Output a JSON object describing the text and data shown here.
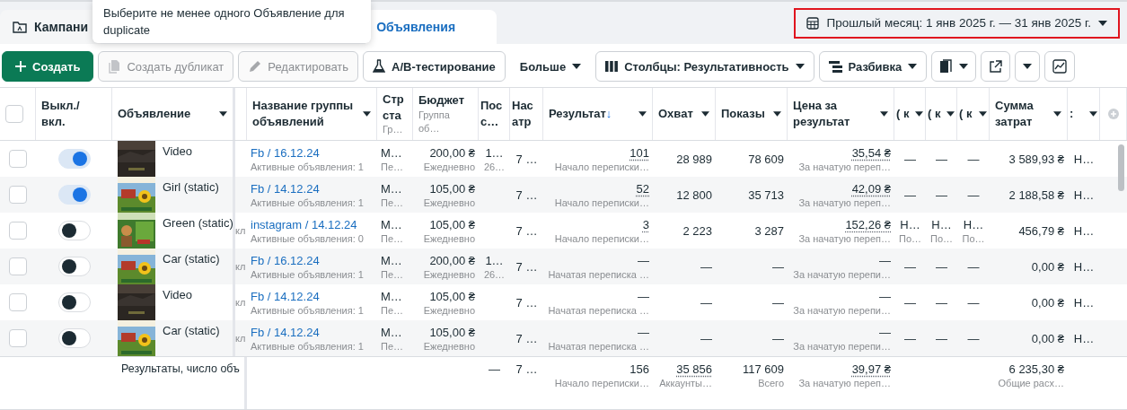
{
  "tooltip": {
    "text": "Выберите не менее одного Объявление для duplicate"
  },
  "tabs": [
    {
      "label": "Кампани",
      "selected": false
    },
    {
      "label": "Объявления",
      "selected": true
    }
  ],
  "date_range": {
    "label": "Прошлый месяц: 1 янв 2025 г. — 31 янв 2025 г.",
    "highlighted": true
  },
  "toolbar": [
    {
      "kind": "primary",
      "label": "Создать",
      "disabled": false,
      "caret": false
    },
    {
      "kind": "button",
      "label": "Создать дубликат",
      "disabled": true,
      "caret": false
    },
    {
      "kind": "button",
      "label": "Редактировать",
      "disabled": true,
      "caret": false
    },
    {
      "kind": "button",
      "label": "A/B-тестирование",
      "disabled": false,
      "caret": false
    },
    {
      "kind": "menu",
      "label": "Больше",
      "disabled": false,
      "caret": true
    },
    {
      "kind": "button",
      "label": "Столбцы: Результативность",
      "disabled": false,
      "caret": true
    },
    {
      "kind": "button",
      "label": "Разбивка",
      "disabled": false,
      "caret": true
    },
    {
      "kind": "icon",
      "disabled": false,
      "caret": true
    },
    {
      "kind": "icon",
      "disabled": false,
      "caret": false
    },
    {
      "kind": "icon",
      "disabled": false,
      "caret": true
    },
    {
      "kind": "icon",
      "disabled": false,
      "caret": false
    }
  ],
  "table": {
    "select_all": {
      "checked": false
    },
    "toggle_column": {
      "label": "Выкл./ вкл."
    },
    "ad_column": {
      "label": "Объявление",
      "caret": true
    },
    "columns": [
      {
        "kind": "text"
      },
      {
        "kind": "link",
        "label": "Название группы объявлений",
        "caret": true
      },
      {
        "kind": "text",
        "label": "Стр ста",
        "sub": "Гр…",
        "caret": false
      },
      {
        "kind": "text",
        "label": "Бюджет",
        "sub": "Группа об…",
        "caret": false
      },
      {
        "kind": "text",
        "label": "Пос с…",
        "caret": false
      },
      {
        "kind": "text",
        "label": "Нас атр",
        "caret": false
      },
      {
        "kind": "text",
        "label": "Результат",
        "sort": "↓",
        "caret": true
      },
      {
        "kind": "text",
        "label": "Охват",
        "caret": true
      },
      {
        "kind": "text",
        "label": "Показы",
        "caret": true
      },
      {
        "kind": "text",
        "label": "Цена за результат",
        "caret": true
      },
      {
        "kind": "text",
        "label": "( к",
        "caret": true
      },
      {
        "kind": "text",
        "label": "( к",
        "caret": true
      },
      {
        "kind": "text",
        "label": "( к",
        "caret": true
      },
      {
        "kind": "text",
        "label": "Сумма затрат",
        "caret": true
      },
      {
        "kind": "text",
        "label": ":",
        "caret": true
      },
      {
        "kind": "add"
      }
    ],
    "rows": [
      {
        "checked": false,
        "on": true,
        "ad": "Video",
        "cells": [
          {},
          {
            "text": "Fb / 16.12.24",
            "sub": "Активные объявления: 1"
          },
          {
            "text": "М…",
            "sub": "Пе…"
          },
          {
            "text": "200,00 ₴",
            "sub": "Ежедневно"
          },
          {
            "text": "1…",
            "sub": "26…"
          },
          {
            "text": "7 …"
          },
          {
            "text": "101",
            "sub": "Начало переписки…",
            "dotted": true
          },
          {
            "text": "28 989"
          },
          {
            "text": "78 609"
          },
          {
            "text": "35,54 ₴",
            "sub": "За начатую переп…",
            "dotted": true
          },
          {
            "text": "—"
          },
          {
            "text": "—"
          },
          {
            "text": "—"
          },
          {
            "text": "3 589,93 ₴"
          },
          {
            "text": "Н…"
          }
        ]
      },
      {
        "checked": false,
        "on": true,
        "ad": "Girl (static)",
        "cells": [
          {},
          {
            "text": "Fb / 14.12.24",
            "sub": "Активные объявления: 1"
          },
          {
            "text": "М…",
            "sub": "Пе…"
          },
          {
            "text": "105,00 ₴",
            "sub": "Ежедневно"
          },
          {},
          {
            "text": "7 …"
          },
          {
            "text": "52",
            "sub": "Начало переписки…",
            "dotted": true
          },
          {
            "text": "12 800"
          },
          {
            "text": "35 713"
          },
          {
            "text": "42,09 ₴",
            "sub": "За начатую переп…",
            "dotted": true
          },
          {
            "text": "—"
          },
          {
            "text": "—"
          },
          {
            "text": "—"
          },
          {
            "text": "2 188,58 ₴"
          },
          {
            "text": "Н…"
          }
        ]
      },
      {
        "checked": false,
        "on": false,
        "ad": "Green (static)",
        "cells": [
          {
            "text": "кл"
          },
          {
            "text": "instagram / 14.12.24",
            "sub": "Активные объявления: 0"
          },
          {
            "text": "М…",
            "sub": "Пе…"
          },
          {
            "text": "105,00 ₴",
            "sub": "Ежедневно"
          },
          {},
          {
            "text": "7 …"
          },
          {
            "text": "3",
            "sub": "Начало переписки…",
            "dotted": true
          },
          {
            "text": "2 223"
          },
          {
            "text": "3 287"
          },
          {
            "text": "152,26 ₴",
            "sub": "За начатую переп…",
            "dotted": true
          },
          {
            "text": "Н…",
            "sub": "По…"
          },
          {
            "text": "Н…",
            "sub": "По…"
          },
          {
            "text": "Н…",
            "sub": "По…"
          },
          {
            "text": "456,79 ₴"
          },
          {
            "text": "Н…"
          }
        ]
      },
      {
        "checked": false,
        "on": false,
        "ad": "Car (static)",
        "cells": [
          {
            "text": "кл"
          },
          {
            "text": "Fb / 16.12.24",
            "sub": "Активные объявления: 1"
          },
          {
            "text": "М…",
            "sub": "Пе…"
          },
          {
            "text": "200,00 ₴",
            "sub": "Ежедневно"
          },
          {
            "text": "1…",
            "sub": "26…"
          },
          {
            "text": "7 …"
          },
          {
            "text": "—",
            "sub": "Начатая переписка …",
            "dotted": false
          },
          {
            "text": "—"
          },
          {
            "text": "—"
          },
          {
            "text": "—",
            "sub": "За начатую перепи…",
            "dotted": false
          },
          {
            "text": "—"
          },
          {
            "text": "—"
          },
          {
            "text": "—"
          },
          {
            "text": "0,00 ₴"
          },
          {
            "text": "Н…"
          }
        ]
      },
      {
        "checked": false,
        "on": false,
        "ad": "Video",
        "cells": [
          {
            "text": "кл"
          },
          {
            "text": "Fb / 14.12.24",
            "sub": "Активные объявления: 1"
          },
          {
            "text": "М…",
            "sub": "Пе…"
          },
          {
            "text": "105,00 ₴",
            "sub": "Ежедневно"
          },
          {},
          {
            "text": "7 …"
          },
          {
            "text": "—",
            "sub": "Начатая переписка …",
            "dotted": false
          },
          {
            "text": "—"
          },
          {
            "text": "—"
          },
          {
            "text": "—",
            "sub": "За начатую перепи…",
            "dotted": false
          },
          {
            "text": "—"
          },
          {
            "text": "—"
          },
          {
            "text": "—"
          },
          {
            "text": "0,00 ₴"
          },
          {
            "text": "Н…"
          }
        ]
      },
      {
        "checked": false,
        "on": false,
        "ad": "Car (static)",
        "cells": [
          {
            "text": "кл"
          },
          {
            "text": "Fb / 14.12.24",
            "sub": "Активные объявления: 1"
          },
          {
            "text": "М…",
            "sub": "Пе…"
          },
          {
            "text": "105,00 ₴",
            "sub": "Ежедневно"
          },
          {},
          {
            "text": "7 …"
          },
          {
            "text": "—",
            "sub": "Начатая переписка …",
            "dotted": false
          },
          {
            "text": "—"
          },
          {
            "text": "—"
          },
          {
            "text": "—",
            "sub": "За начатую перепи…",
            "dotted": false
          },
          {
            "text": "—"
          },
          {
            "text": "—"
          },
          {
            "text": "—"
          },
          {
            "text": "0,00 ₴"
          },
          {
            "text": "Н…"
          }
        ]
      }
    ],
    "footer": {
      "label": "Результаты, число объ",
      "cells": [
        {},
        {},
        {},
        {},
        {
          "text": "—"
        },
        {
          "text": "7 …"
        },
        {
          "text": "156",
          "sub": "Начало переписки…",
          "dotted": false
        },
        {
          "text": "35 856",
          "sub": "Аккаунты…",
          "dotted": true
        },
        {
          "text": "117 609",
          "sub": "Всего"
        },
        {
          "text": "39,97 ₴",
          "sub": "За начатую переп…",
          "dotted": true
        },
        {},
        {},
        {},
        {
          "text": "6 235,30 ₴",
          "sub": "Общие расх…"
        },
        {}
      ]
    }
  }
}
